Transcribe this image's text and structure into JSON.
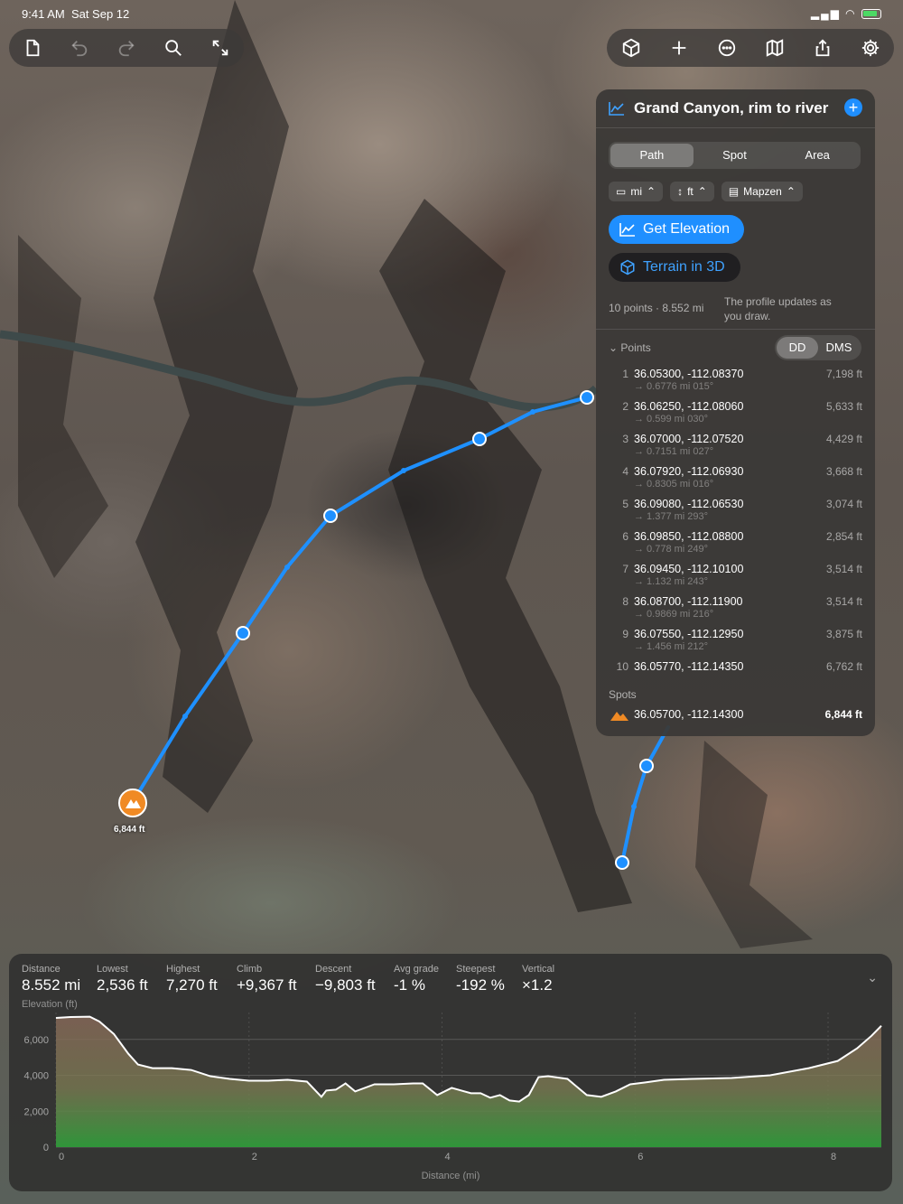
{
  "status": {
    "time": "9:41 AM",
    "date": "Sat Sep 12"
  },
  "toolbar_left": [
    {
      "name": "new-document-icon",
      "glyph": "doc"
    },
    {
      "name": "undo-icon",
      "glyph": "undo"
    },
    {
      "name": "redo-icon",
      "glyph": "redo"
    },
    {
      "name": "search-icon",
      "glyph": "search"
    },
    {
      "name": "expand-icon",
      "glyph": "expand"
    }
  ],
  "toolbar_right": [
    {
      "name": "3d-cube-icon"
    },
    {
      "name": "plus-icon"
    },
    {
      "name": "more-icon"
    },
    {
      "name": "map-icon"
    },
    {
      "name": "share-icon"
    },
    {
      "name": "settings-gear-icon"
    }
  ],
  "panel": {
    "title": "Grand Canyon, rim to river",
    "add": "+",
    "tabs": [
      "Path",
      "Spot",
      "Area"
    ],
    "selected_tab": "Path",
    "chips": [
      "mi",
      "ft",
      "Mapzen"
    ],
    "get_elevation": "Get Elevation",
    "terrain_3d": "Terrain in 3D",
    "summary": "10 points · 8.552 mi",
    "hint": "The profile updates as you draw.",
    "points_label": "Points",
    "formats": [
      "DD",
      "DMS"
    ],
    "points": [
      {
        "n": "1",
        "coord": "36.05300, -112.08370",
        "elev": "7,198 ft",
        "seg": "→ 0.6776 mi  015°"
      },
      {
        "n": "2",
        "coord": "36.06250, -112.08060",
        "elev": "5,633 ft",
        "seg": "→ 0.599 mi  030°"
      },
      {
        "n": "3",
        "coord": "36.07000, -112.07520",
        "elev": "4,429 ft",
        "seg": "→ 0.7151 mi  027°"
      },
      {
        "n": "4",
        "coord": "36.07920, -112.06930",
        "elev": "3,668 ft",
        "seg": "→ 0.8305 mi  016°"
      },
      {
        "n": "5",
        "coord": "36.09080, -112.06530",
        "elev": "3,074 ft",
        "seg": "→ 1.377 mi  293°"
      },
      {
        "n": "6",
        "coord": "36.09850, -112.08800",
        "elev": "2,854 ft",
        "seg": "→ 0.778 mi  249°"
      },
      {
        "n": "7",
        "coord": "36.09450, -112.10100",
        "elev": "3,514 ft",
        "seg": "→ 1.132 mi  243°"
      },
      {
        "n": "8",
        "coord": "36.08700, -112.11900",
        "elev": "3,514 ft",
        "seg": "→ 0.9869 mi  216°"
      },
      {
        "n": "9",
        "coord": "36.07550, -112.12950",
        "elev": "3,875 ft",
        "seg": "→ 1.456 mi  212°"
      },
      {
        "n": "10",
        "coord": "36.05770, -112.14350",
        "elev": "6,762 ft",
        "seg": ""
      }
    ],
    "spots_label": "Spots",
    "spot": {
      "coord": "36.05700, -112.14300",
      "elev": "6,844 ft"
    }
  },
  "map": {
    "spot_label": "6,844 ft"
  },
  "stats": [
    {
      "label": "Distance",
      "value": "8.552 mi"
    },
    {
      "label": "Lowest",
      "value": "2,536 ft"
    },
    {
      "label": "Highest",
      "value": "7,270 ft"
    },
    {
      "label": "Climb",
      "value": "+9,367 ft"
    },
    {
      "label": "Descent",
      "value": "−9,803 ft"
    },
    {
      "label": "Avg grade",
      "value": "-1 %"
    },
    {
      "label": "Steepest",
      "value": "-192 %"
    },
    {
      "label": "Vertical",
      "value": "×1.2"
    }
  ],
  "colors": {
    "accent": "#1f8fff",
    "route": "#1e90ff",
    "spot": "#f08a24"
  },
  "chart_data": {
    "type": "area",
    "ylabel": "Elevation (ft)",
    "xlabel": "Distance (mi)",
    "xlim": [
      0,
      8.552
    ],
    "ylim": [
      0,
      7500
    ],
    "yticks": [
      0,
      2000,
      4000,
      6000
    ],
    "xticks": [
      0,
      2,
      4,
      6,
      8
    ],
    "series": [
      {
        "x": [
          0,
          0.15,
          0.35,
          0.45,
          0.6,
          0.75,
          0.85,
          1.0,
          1.2,
          1.4,
          1.6,
          1.8,
          2.0,
          2.2,
          2.4,
          2.6,
          2.75,
          2.8,
          2.9,
          3.0,
          3.1,
          3.3,
          3.5,
          3.7,
          3.8,
          3.95,
          4.1,
          4.3,
          4.4,
          4.5,
          4.6,
          4.7,
          4.8,
          4.9,
          5.0,
          5.1,
          5.3,
          5.5,
          5.65,
          5.8,
          5.95,
          6.1,
          6.3,
          6.6,
          7.0,
          7.4,
          7.8,
          8.1,
          8.3,
          8.45,
          8.552
        ],
        "y": [
          7200,
          7250,
          7270,
          7000,
          6300,
          5200,
          4600,
          4400,
          4400,
          4300,
          3950,
          3800,
          3700,
          3700,
          3750,
          3650,
          2800,
          3150,
          3200,
          3550,
          3100,
          3500,
          3500,
          3550,
          3550,
          2900,
          3300,
          3000,
          3000,
          2750,
          2900,
          2600,
          2536,
          2900,
          3900,
          3950,
          3800,
          2900,
          2800,
          3100,
          3500,
          3600,
          3750,
          3800,
          3850,
          4000,
          4400,
          4800,
          5500,
          6200,
          6762
        ]
      }
    ]
  }
}
